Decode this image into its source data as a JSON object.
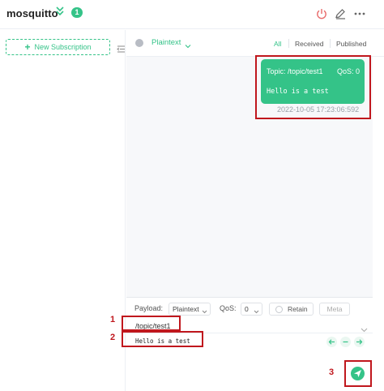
{
  "header": {
    "connection_name": "mosquitto",
    "badge_count": "1",
    "icons": [
      "chevrons-down-icon",
      "power-icon",
      "edit-icon",
      "more-icon"
    ]
  },
  "sidebar": {
    "new_subscription_label": "New Subscription"
  },
  "message_toolbar": {
    "format_label": "Plaintext",
    "filters": {
      "all": "All",
      "received": "Received",
      "published": "Published"
    },
    "active_filter": "All"
  },
  "messages": [
    {
      "topic_text": "Topic: /topic/test1",
      "qos_text": "QoS: 0",
      "payload": "Hello is a test",
      "time": "2022-10-05 17:23:06:592"
    }
  ],
  "publish": {
    "payload_label": "Payload:",
    "payload_format": "Plaintext",
    "qos_label": "QoS:",
    "qos_value": "0",
    "retain_label": "Retain",
    "meta_label": "Meta",
    "topic_value": "/topic/test1",
    "payload_value": "Hello is a test"
  },
  "annotations": {
    "marker_1": "1",
    "marker_2": "2",
    "marker_3": "3"
  },
  "colors": {
    "accent": "#34c388",
    "annotation": "#c0171d",
    "danger_icon": "#e86b6b",
    "muted_text": "#9aa0a8"
  }
}
